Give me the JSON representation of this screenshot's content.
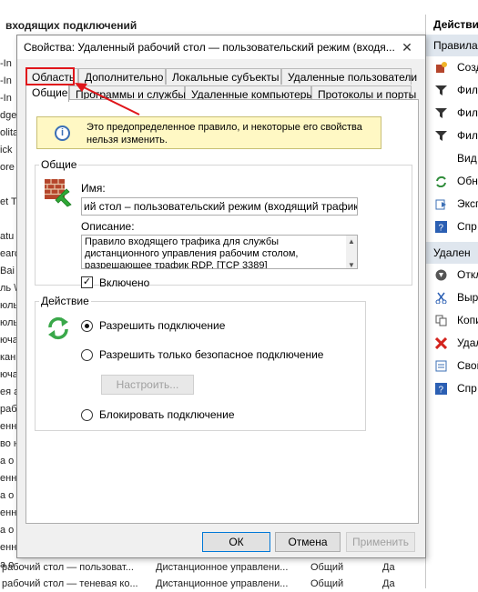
{
  "background": {
    "title": "входящих подключений",
    "left_rows": [
      "-In",
      "-In",
      "-In",
      "dge",
      "olita",
      "ick",
      "ore",
      "",
      "et T",
      "",
      "atu",
      "earc",
      "Bai",
      "ль \\",
      "юль",
      "юль",
      "юча",
      "кан",
      "юча",
      "ея а",
      "рабо",
      "енни",
      "во н",
      "а о",
      "енни",
      "а о",
      "енни",
      "а о",
      "енни",
      "а о"
    ],
    "bottom_rows": [
      {
        "name": "рабочий стол — пользоват...",
        "group": "Дистанционное управлени...",
        "profile": "Общий",
        "enabled": "Да"
      },
      {
        "name": "рабочий стол — теневая ко...",
        "group": "Дистанционное управлени...",
        "profile": "Общий",
        "enabled": "Да"
      }
    ]
  },
  "actions": {
    "header": "Действия",
    "section1": "Правила",
    "items1": [
      {
        "label": "Созд",
        "icon": "new-rule-icon"
      },
      {
        "label": "Фил",
        "icon": "filter-icon"
      },
      {
        "label": "Фил",
        "icon": "filter-icon"
      },
      {
        "label": "Фил",
        "icon": "filter-icon"
      },
      {
        "label": "Вид",
        "icon": ""
      },
      {
        "label": "Обн",
        "icon": "refresh-icon"
      },
      {
        "label": "Эксп",
        "icon": "export-icon"
      },
      {
        "label": "Спр",
        "icon": "help-icon"
      }
    ],
    "section2": "Удален",
    "items2": [
      {
        "label": "Откл",
        "icon": "disable-icon"
      },
      {
        "label": "Выр",
        "icon": "cut-icon"
      },
      {
        "label": "Копи",
        "icon": "copy-icon"
      },
      {
        "label": "Удал",
        "icon": "delete-icon"
      },
      {
        "label": "Свой",
        "icon": "properties-icon"
      },
      {
        "label": "Спр",
        "icon": "help-icon"
      }
    ]
  },
  "dialog": {
    "title": "Свойства: Удаленный рабочий стол — пользовательский режим (входя...",
    "close": "✕",
    "tabs_row1": [
      "Область",
      "Дополнительно",
      "Локальные субъекты",
      "Удаленные пользователи"
    ],
    "tabs_row2": [
      "Общие",
      "Программы и службы",
      "Удаленные компьютеры",
      "Протоколы и порты"
    ],
    "info_text": "Это предопределенное правило, и некоторые его свойства нельзя изменить.",
    "general_legend": "Общие",
    "name_label": "Имя:",
    "name_value": "ий стол – пользовательский режим (входящий трафик TCI",
    "desc_label": "Описание:",
    "desc_value": "Правило входящего трафика для службы дистанционного управления рабочим столом, разрешающее трафик RDP. [TCP 3389]",
    "enabled_label": "Включено",
    "enabled": true,
    "action_legend": "Действие",
    "radio_allow": "Разрешить подключение",
    "radio_secure": "Разрешить только безопасное подключение",
    "configure_btn": "Настроить...",
    "radio_block": "Блокировать подключение",
    "selected_action": "allow",
    "ok": "ОК",
    "cancel": "Отмена",
    "apply": "Применить"
  },
  "colors": {
    "highlight": "#e0161b",
    "info_bg": "#fff8c4",
    "accent": "#0078d7"
  }
}
